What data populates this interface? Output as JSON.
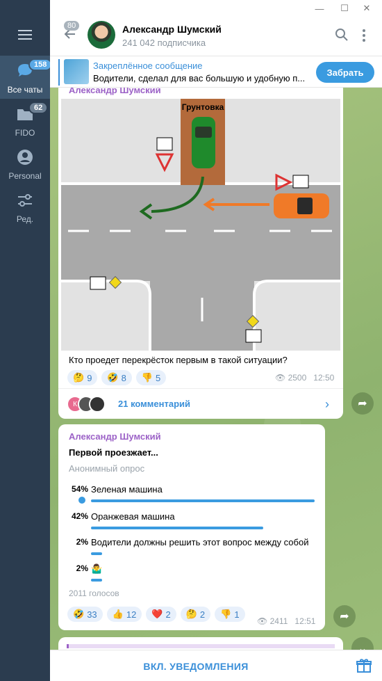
{
  "sidebar": {
    "items": [
      {
        "label": "Все чаты",
        "badge": "158",
        "icon": "chats-icon"
      },
      {
        "label": "FIDO",
        "badge": "62",
        "icon": "folder-icon"
      },
      {
        "label": "Personal",
        "badge": "",
        "icon": "person-icon"
      },
      {
        "label": "Ред.",
        "badge": "",
        "icon": "edit-filters-icon"
      }
    ]
  },
  "header": {
    "back_count": "80",
    "title": "Александр Шумский",
    "subscribers": "241 042 подписчика"
  },
  "pinned": {
    "title": "Закреплённое сообщение",
    "text": "Водители, сделал для вас большую и удобную п...",
    "button": "Забрать"
  },
  "post1": {
    "author": "Александр Шумский",
    "image_label": "Грунтовка",
    "caption": "Кто проедет перекрёсток первым в такой ситуации?",
    "reactions": [
      {
        "emoji": "🤔",
        "count": "9"
      },
      {
        "emoji": "🤣",
        "count": "8"
      },
      {
        "emoji": "👎",
        "count": "5"
      }
    ],
    "views": "2500",
    "time": "12:50",
    "comments": "21 комментарий",
    "comment_avatar_letter": "К"
  },
  "post2": {
    "author": "Александр Шумский",
    "question": "Первой проезжает...",
    "poll_type": "Анонимный опрос",
    "options": [
      {
        "pct": "54%",
        "text": "Зеленая машина",
        "value": 54,
        "chosen": true
      },
      {
        "pct": "42%",
        "text": "Оранжевая машина",
        "value": 42,
        "chosen": false
      },
      {
        "pct": "2%",
        "text": "Водители должны решить этот вопрос между собой",
        "value": 2,
        "chosen": false
      },
      {
        "pct": "2%",
        "text": "🤷‍♂️",
        "value": 2,
        "chosen": false
      }
    ],
    "votes": "2011 голосов",
    "reactions": [
      {
        "emoji": "🤣",
        "count": "33"
      },
      {
        "emoji": "👍",
        "count": "12"
      },
      {
        "emoji": "❤️",
        "count": "2"
      },
      {
        "emoji": "🤔",
        "count": "2"
      },
      {
        "emoji": "👎",
        "count": "1"
      }
    ],
    "views": "2411",
    "time": "12:51"
  },
  "bottom": {
    "notify": "ВКЛ. УВЕДОМЛЕНИЯ"
  },
  "colors": {
    "sidebar": "#2b3c4f",
    "accent": "#3a9be0",
    "author": "#9c62c7",
    "chat_bg": "#9cb976"
  }
}
